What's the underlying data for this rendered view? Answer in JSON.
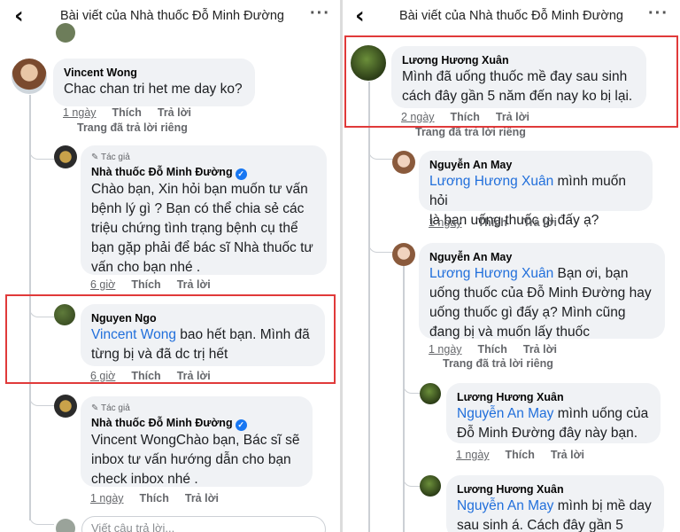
{
  "left": {
    "header": {
      "title": "Bài viết của Nhà thuốc Đỗ Minh Đường"
    },
    "comments": [
      {
        "author": "Vincent Wong",
        "text": "Chac chan tri het me day ko?",
        "time": "1 ngày",
        "like": "Thích",
        "reply": "Trả lời",
        "note": "Trang đã trả lời riêng"
      },
      {
        "badge": "Tác giả",
        "author": "Nhà thuốc Đỗ Minh Đường",
        "lines": [
          "Chào bạn, Xin hỏi bạn muốn tư vấn",
          "bệnh lý gì ? Bạn có thể chia sẻ các",
          "triệu chứng tình trạng bệnh  cụ thể",
          "bạn gặp phải để bác sĩ Nhà thuốc tư",
          "vấn cho bạn nhé ."
        ],
        "time": "6 giờ",
        "like": "Thích",
        "reply": "Trả lời"
      },
      {
        "author": "Nguyen Ngo",
        "mention": "Vincent Wong",
        "line1_rest": " bao hết bạn. Mình đã",
        "line2": "từng bị và đã dc trị hết",
        "time": "6 giờ",
        "like": "Thích",
        "reply": "Trả lời"
      },
      {
        "badge": "Tác giả",
        "author": "Nhà thuốc Đỗ Minh Đường",
        "lines": [
          "Vincent WongChào bạn, Bác sĩ sẽ",
          "inbox tư vấn hướng dẫn cho bạn",
          "check inbox nhé ."
        ],
        "time": "1 ngày",
        "like": "Thích",
        "reply": "Trả lời"
      }
    ],
    "input_placeholder": "Viết câu trả lời..."
  },
  "right": {
    "header": {
      "title": "Bài viết của Nhà thuốc Đỗ Minh Đường"
    },
    "comments": [
      {
        "author": "Lương Hương Xuân",
        "lines": [
          "Mình đã uống thuốc mề đay sau sinh",
          "cách đây gần 5 năm đến nay ko bị lại."
        ],
        "time": "2 ngày",
        "like": "Thích",
        "reply": "Trả lời",
        "note": "Trang đã trả lời riêng"
      },
      {
        "author": "Nguyễn An May",
        "mention": "Lương Hương Xuân",
        "line1_rest": " mình muốn hỏi",
        "rest": [
          "là bạn uống thuốc gì đấy ạ?"
        ],
        "time": "1 ngày",
        "like": "Thích",
        "reply": "Trả lời"
      },
      {
        "author": "Nguyễn An May",
        "mention": "Lương Hương Xuân",
        "line1_rest": " Bạn ơi, bạn",
        "rest": [
          "uống thuốc của Đỗ Minh Đường hay",
          "uống thuốc gì đấy ạ? Mình cũng",
          "đang bị và muốn lấy thuốc"
        ],
        "time": "1 ngày",
        "like": "Thích",
        "reply": "Trả lời",
        "note": "Trang đã trả lời riêng"
      },
      {
        "author": "Lương Hương Xuân",
        "mention": "Nguyễn An May",
        "line1_rest": " mình uống của",
        "rest": [
          "Đỗ Minh Đường đây này bạn."
        ],
        "time": "1 ngày",
        "like": "Thích",
        "reply": "Trả lời"
      },
      {
        "author": "Lương Hương Xuân",
        "mention": "Nguyễn An May",
        "line1_rest": " mình bị mề day",
        "rest": [
          "sau sinh á. Cách đây gần 5"
        ]
      }
    ]
  },
  "colors": {
    "highlight": "#e03a3a",
    "mention": "#216fdb",
    "bubble": "#f0f2f5",
    "verified": "#1877f2"
  }
}
